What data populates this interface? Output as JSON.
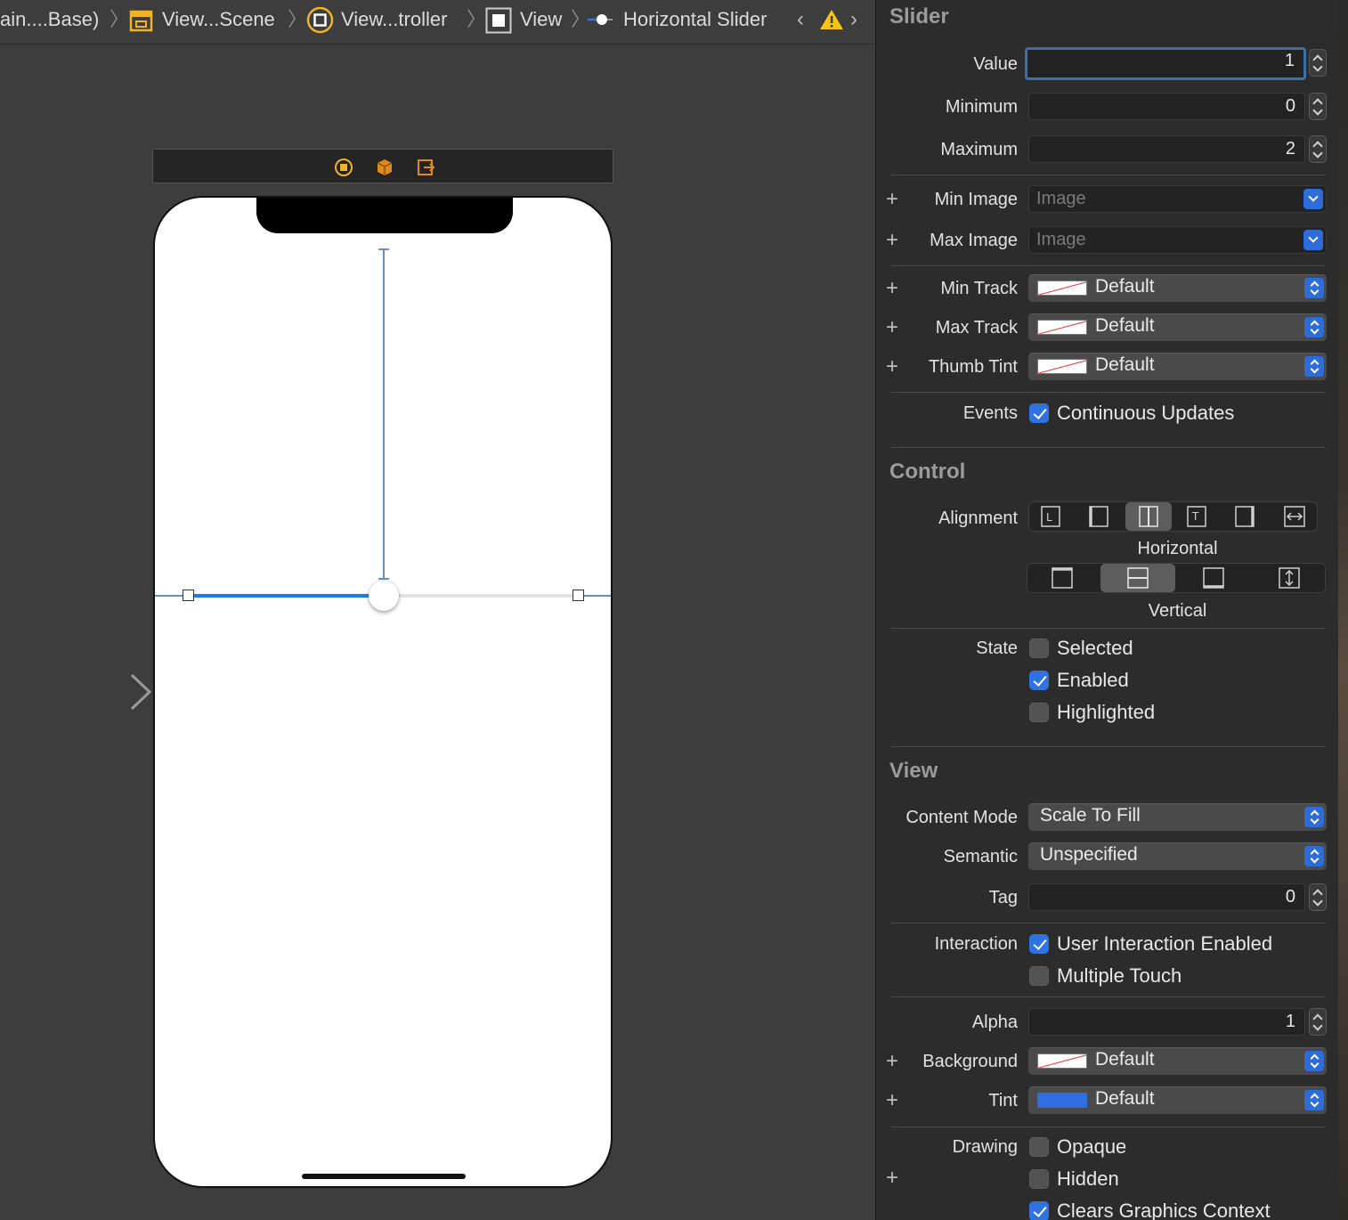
{
  "breadcrumb": {
    "items": [
      {
        "label": "ain....Base)"
      },
      {
        "label": "View...Scene"
      },
      {
        "label": "View...troller"
      },
      {
        "label": "View"
      },
      {
        "label": "Horizontal Slider"
      }
    ]
  },
  "canvas": {
    "slider": {
      "value": 1,
      "minimum": 0,
      "maximum": 2
    }
  },
  "inspector": {
    "slider_section": {
      "title": "Slider",
      "value": {
        "label": "Value",
        "value": "1"
      },
      "minimum": {
        "label": "Minimum",
        "value": "0"
      },
      "maximum": {
        "label": "Maximum",
        "value": "2"
      },
      "min_image": {
        "label": "Min Image",
        "placeholder": "Image"
      },
      "max_image": {
        "label": "Max Image",
        "placeholder": "Image"
      },
      "min_track": {
        "label": "Min Track",
        "value": "Default"
      },
      "max_track": {
        "label": "Max Track",
        "value": "Default"
      },
      "thumb_tint": {
        "label": "Thumb Tint",
        "value": "Default"
      },
      "events": {
        "label": "Events",
        "option": "Continuous Updates",
        "checked": true
      }
    },
    "control_section": {
      "title": "Control",
      "alignment_label": "Alignment",
      "horizontal_caption": "Horizontal",
      "vertical_caption": "Vertical",
      "state_label": "State",
      "states": [
        {
          "label": "Selected",
          "checked": false
        },
        {
          "label": "Enabled",
          "checked": true
        },
        {
          "label": "Highlighted",
          "checked": false
        }
      ]
    },
    "view_section": {
      "title": "View",
      "content_mode": {
        "label": "Content Mode",
        "value": "Scale To Fill"
      },
      "semantic": {
        "label": "Semantic",
        "value": "Unspecified"
      },
      "tag": {
        "label": "Tag",
        "value": "0"
      },
      "interaction_label": "Interaction",
      "interaction": [
        {
          "label": "User Interaction Enabled",
          "checked": true
        },
        {
          "label": "Multiple Touch",
          "checked": false
        }
      ],
      "alpha": {
        "label": "Alpha",
        "value": "1"
      },
      "background": {
        "label": "Background",
        "value": "Default"
      },
      "tint": {
        "label": "Tint",
        "value": "Default"
      },
      "drawing_label": "Drawing",
      "drawing": [
        {
          "label": "Opaque",
          "checked": false
        },
        {
          "label": "Hidden",
          "checked": false
        },
        {
          "label": "Clears Graphics Context",
          "checked": true
        }
      ]
    }
  },
  "colors": {
    "accent": "#2f72e0",
    "slider_min_track": "#1a7cf2",
    "slider_max_track": "#e4e4e4",
    "warning": "#f5c518",
    "scene_icon": "#f0b429"
  }
}
